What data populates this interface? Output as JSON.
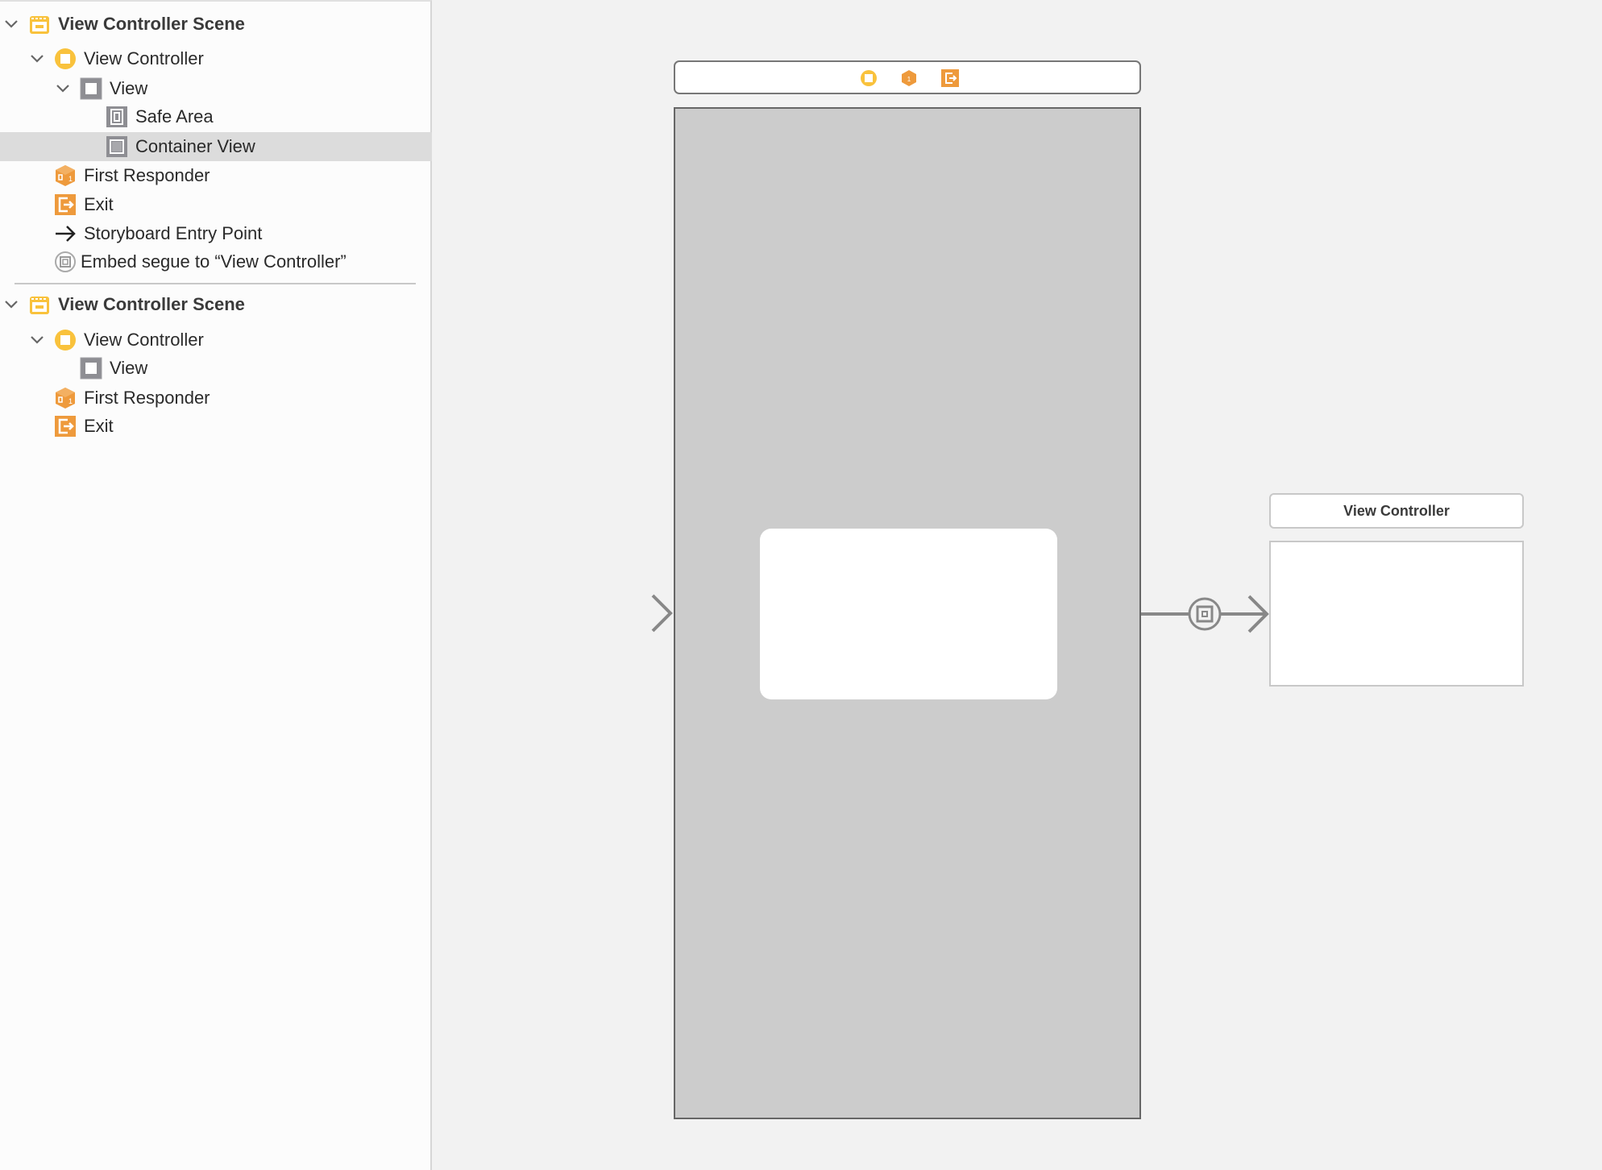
{
  "outline": {
    "scenes": [
      {
        "title": "View Controller Scene",
        "items": [
          {
            "label": "View Controller",
            "icon": "view-controller-icon"
          },
          {
            "label": "View",
            "icon": "view-icon"
          },
          {
            "label": "Safe Area",
            "icon": "safe-area-icon"
          },
          {
            "label": "Container View",
            "icon": "container-view-icon",
            "selected": true
          },
          {
            "label": "First Responder",
            "icon": "first-responder-icon"
          },
          {
            "label": "Exit",
            "icon": "exit-icon"
          },
          {
            "label": "Storyboard Entry Point",
            "icon": "arrow-right-icon"
          },
          {
            "label": "Embed segue to “View Controller”",
            "icon": "embed-segue-icon"
          }
        ]
      },
      {
        "title": "View Controller Scene",
        "items": [
          {
            "label": "View Controller",
            "icon": "view-controller-icon"
          },
          {
            "label": "View",
            "icon": "view-icon"
          },
          {
            "label": "First Responder",
            "icon": "first-responder-icon"
          },
          {
            "label": "Exit",
            "icon": "exit-icon"
          }
        ]
      }
    ]
  },
  "canvas": {
    "embedded_scene_title": "View Controller"
  },
  "colors": {
    "scene_yellow": "#f9c23c",
    "responder_orange": "#ee9a3c",
    "selection": "#dcdcdc",
    "canvas_bg": "#f2f2f2",
    "view_gray": "#cccccc"
  }
}
